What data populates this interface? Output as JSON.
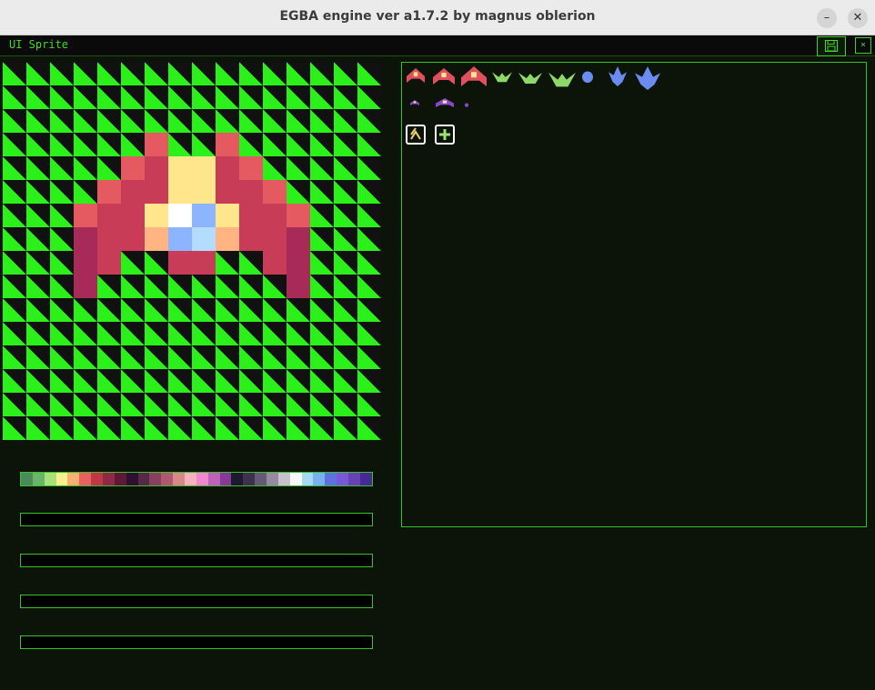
{
  "window": {
    "title": "EGBA engine ver a1.7.2 by magnus oblerion",
    "minimize_glyph": "–",
    "close_glyph": "✕"
  },
  "menubar": {
    "panel_label": "UI Sprite",
    "save_icon": "floppy-disk-icon",
    "close_glyph": "×"
  },
  "colors": {
    "checker_green": "#2bf01a",
    "checker_dark": "#111111",
    "accent": "#35c226"
  },
  "sprite_editor": {
    "grid_size": 16,
    "pixels": [
      {
        "r": 3,
        "c": 6,
        "color": "#e45a60"
      },
      {
        "r": 3,
        "c": 9,
        "color": "#e45a60"
      },
      {
        "r": 4,
        "c": 5,
        "color": "#e45a60"
      },
      {
        "r": 4,
        "c": 6,
        "color": "#c83c58"
      },
      {
        "r": 4,
        "c": 7,
        "color": "#ffe68c"
      },
      {
        "r": 4,
        "c": 8,
        "color": "#ffe68c"
      },
      {
        "r": 4,
        "c": 9,
        "color": "#c83c58"
      },
      {
        "r": 4,
        "c": 10,
        "color": "#e45a60"
      },
      {
        "r": 5,
        "c": 4,
        "color": "#e45a60"
      },
      {
        "r": 5,
        "c": 5,
        "color": "#c83c58"
      },
      {
        "r": 5,
        "c": 6,
        "color": "#c83c58"
      },
      {
        "r": 5,
        "c": 7,
        "color": "#ffe68c"
      },
      {
        "r": 5,
        "c": 8,
        "color": "#ffe68c"
      },
      {
        "r": 5,
        "c": 9,
        "color": "#c83c58"
      },
      {
        "r": 5,
        "c": 10,
        "color": "#c83c58"
      },
      {
        "r": 5,
        "c": 11,
        "color": "#e45a60"
      },
      {
        "r": 6,
        "c": 3,
        "color": "#e45a60"
      },
      {
        "r": 6,
        "c": 4,
        "color": "#c83c58"
      },
      {
        "r": 6,
        "c": 5,
        "color": "#c83c58"
      },
      {
        "r": 6,
        "c": 6,
        "color": "#ffe68c"
      },
      {
        "r": 6,
        "c": 7,
        "color": "#ffffff"
      },
      {
        "r": 6,
        "c": 8,
        "color": "#8cb4ff"
      },
      {
        "r": 6,
        "c": 9,
        "color": "#ffe68c"
      },
      {
        "r": 6,
        "c": 10,
        "color": "#c83c58"
      },
      {
        "r": 6,
        "c": 11,
        "color": "#c83c58"
      },
      {
        "r": 6,
        "c": 12,
        "color": "#e45a60"
      },
      {
        "r": 7,
        "c": 3,
        "color": "#a82a58"
      },
      {
        "r": 7,
        "c": 4,
        "color": "#c83c58"
      },
      {
        "r": 7,
        "c": 5,
        "color": "#c83c58"
      },
      {
        "r": 7,
        "c": 6,
        "color": "#ffb482"
      },
      {
        "r": 7,
        "c": 7,
        "color": "#8cb4ff"
      },
      {
        "r": 7,
        "c": 8,
        "color": "#b4dcff"
      },
      {
        "r": 7,
        "c": 9,
        "color": "#ffb482"
      },
      {
        "r": 7,
        "c": 10,
        "color": "#c83c58"
      },
      {
        "r": 7,
        "c": 11,
        "color": "#c83c58"
      },
      {
        "r": 7,
        "c": 12,
        "color": "#a82a58"
      },
      {
        "r": 8,
        "c": 3,
        "color": "#a82a58"
      },
      {
        "r": 8,
        "c": 4,
        "color": "#c83c58"
      },
      {
        "r": 8,
        "c": 7,
        "color": "#c83c58"
      },
      {
        "r": 8,
        "c": 8,
        "color": "#c83c58"
      },
      {
        "r": 8,
        "c": 11,
        "color": "#c83c58"
      },
      {
        "r": 8,
        "c": 12,
        "color": "#a82a58"
      },
      {
        "r": 9,
        "c": 3,
        "color": "#a82a58"
      },
      {
        "r": 9,
        "c": 12,
        "color": "#a82a58"
      }
    ]
  },
  "palette": [
    "#4c8a5a",
    "#6ab46a",
    "#a8e07a",
    "#f8f090",
    "#f8b070",
    "#e86060",
    "#c03848",
    "#902848",
    "#601838",
    "#301030",
    "#582848",
    "#884060",
    "#b05870",
    "#d88888",
    "#f8b0c0",
    "#f088d0",
    "#c060b8",
    "#883898",
    "#201830",
    "#403050",
    "#685878",
    "#9888a0",
    "#c8c0d0",
    "#f8f8f8",
    "#a8d8f8",
    "#78b0f0",
    "#6070e0",
    "#7858d8",
    "#6840b8",
    "#482898"
  ],
  "sprite_sheet": {
    "sprites": [
      {
        "name": "red-ship-icon",
        "color": "#e05060"
      },
      {
        "name": "red-ship-large-icon",
        "color": "#e05060"
      },
      {
        "name": "red-ship-xl-icon",
        "color": "#e05060"
      },
      {
        "name": "green-bird-icon",
        "color": "#8ed86a"
      },
      {
        "name": "green-bird-large-icon",
        "color": "#8ed86a"
      },
      {
        "name": "green-bird-xl-icon",
        "color": "#8ed86a"
      },
      {
        "name": "blue-drop-icon",
        "color": "#6a8cf0"
      },
      {
        "name": "blue-ship-icon",
        "color": "#6a8cf0"
      },
      {
        "name": "blue-ship-large-icon",
        "color": "#6a8cf0"
      },
      {
        "name": "purple-bug-small-icon",
        "color": "#8848c8"
      },
      {
        "name": "purple-bug-icon",
        "color": "#8848c8"
      },
      {
        "name": "purple-dot-icon",
        "color": "#8848c8"
      },
      {
        "name": "chevron-up-badge-icon",
        "color": "#f0d070"
      },
      {
        "name": "plus-badge-icon",
        "color": "#a0e070"
      }
    ]
  }
}
